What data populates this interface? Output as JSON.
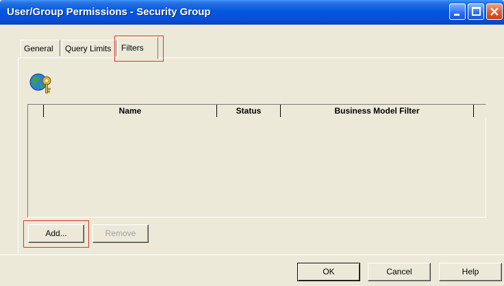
{
  "window": {
    "title": "User/Group Permissions - Security Group"
  },
  "titlebar_buttons": {
    "minimize": "minimize-icon",
    "maximize": "maximize-icon",
    "close": "close-icon"
  },
  "tabs": [
    {
      "label": "General",
      "selected": false
    },
    {
      "label": "Query Limits",
      "selected": false
    },
    {
      "label": "Filters",
      "selected": true
    }
  ],
  "filters": {
    "icon": "globe-key-icon",
    "columns": [
      "",
      "Name",
      "Status",
      "Business Model Filter",
      ""
    ],
    "rows": []
  },
  "buttons": {
    "add": "Add...",
    "remove": "Remove",
    "ok": "OK",
    "cancel": "Cancel",
    "help": "Help"
  },
  "colors": {
    "titlebar": "#0058e0",
    "dialog": "#ece9d8",
    "highlight": "#e03030"
  }
}
